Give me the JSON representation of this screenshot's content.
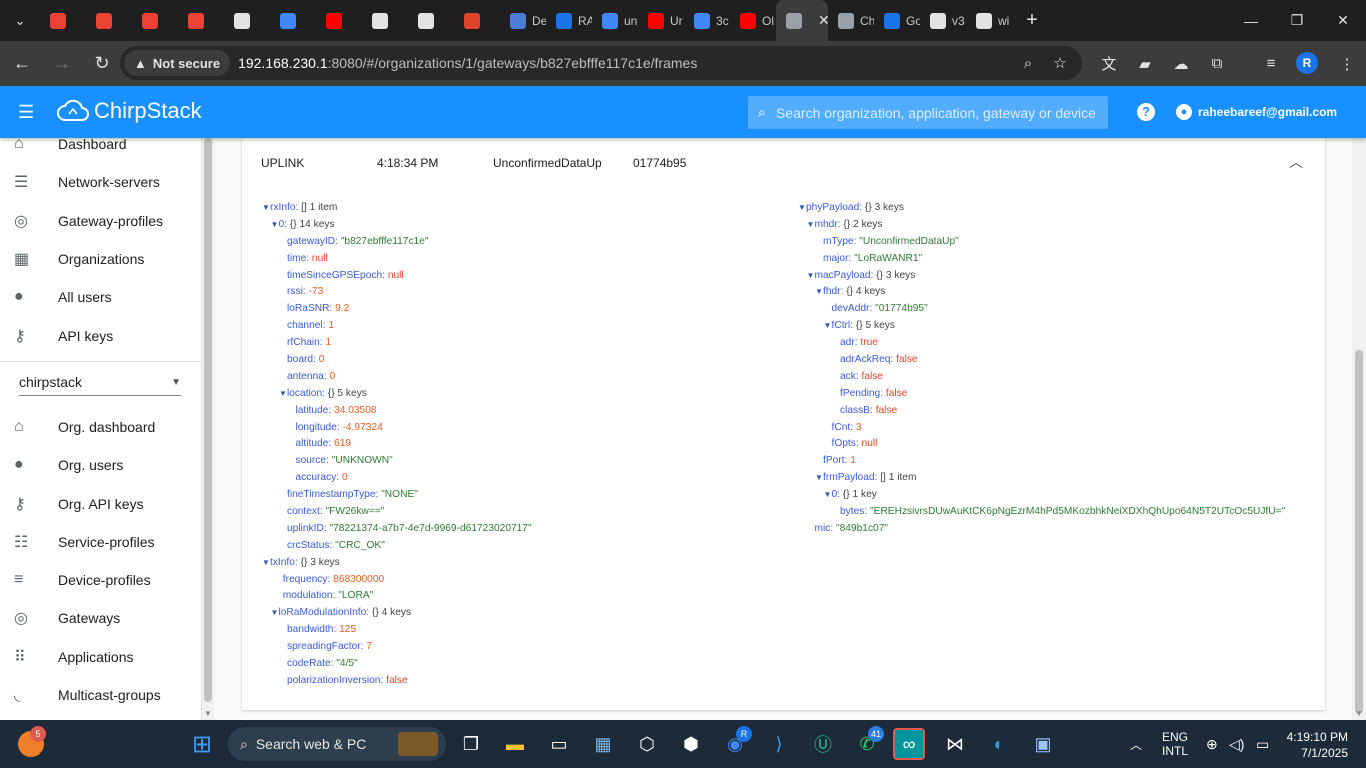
{
  "browser": {
    "tabs": [
      {
        "title": "",
        "color": "#ea4335"
      },
      {
        "title": "",
        "color": "#ea4335"
      },
      {
        "title": "",
        "color": "#ea4335"
      },
      {
        "title": "",
        "color": "#ea4335"
      },
      {
        "title": "",
        "color": "#e3e3e3"
      },
      {
        "title": "",
        "color": "#4285f4"
      },
      {
        "title": "",
        "color": "#ff0000"
      },
      {
        "title": "",
        "color": "#e3e3e3"
      },
      {
        "title": "",
        "color": "#e3e3e3"
      },
      {
        "title": "",
        "color": "#e0442c"
      },
      {
        "title": "De",
        "color": "#4c7bd8"
      },
      {
        "title": "RA",
        "color": "#1a73e8"
      },
      {
        "title": "un",
        "color": "#4285f4"
      },
      {
        "title": "Ur",
        "color": "#ff0000"
      },
      {
        "title": "3c",
        "color": "#4285f4"
      },
      {
        "title": "Ol",
        "color": "#ff0000"
      },
      {
        "title": "",
        "color": "#9aa0a6",
        "active": true
      },
      {
        "title": "Ch",
        "color": "#9aa0a6"
      },
      {
        "title": "Go",
        "color": "#1a73e8"
      },
      {
        "title": "v3",
        "color": "#e3e3e3"
      },
      {
        "title": "wi",
        "color": "#e3e3e3"
      }
    ],
    "not_secure": "Not secure",
    "url_host": "192.168.230.1",
    "url_rest": ":8080/#/organizations/1/gateways/b827ebfffe117c1e/frames",
    "profile_initial": "R"
  },
  "app": {
    "brand": "ChirpStack",
    "search_placeholder": "Search organization, application, gateway or device",
    "user_email": "raheebareef@gmail.com",
    "accent": "#1890ff"
  },
  "sidebar": {
    "top_items": [
      {
        "label": "Dashboard",
        "icon": "home-icon"
      },
      {
        "label": "Network-servers",
        "icon": "servers-icon"
      },
      {
        "label": "Gateway-profiles",
        "icon": "gateway-icon"
      },
      {
        "label": "Organizations",
        "icon": "domain-icon"
      },
      {
        "label": "All users",
        "icon": "user-icon"
      },
      {
        "label": "API keys",
        "icon": "key-icon"
      }
    ],
    "org_selected": "chirpstack",
    "org_items": [
      {
        "label": "Org. dashboard",
        "icon": "home-icon"
      },
      {
        "label": "Org. users",
        "icon": "user-icon"
      },
      {
        "label": "Org. API keys",
        "icon": "key-icon"
      },
      {
        "label": "Service-profiles",
        "icon": "account-details-icon"
      },
      {
        "label": "Device-profiles",
        "icon": "tune-icon"
      },
      {
        "label": "Gateways",
        "icon": "gateway-icon"
      },
      {
        "label": "Applications",
        "icon": "apps-icon"
      },
      {
        "label": "Multicast-groups",
        "icon": "rss-icon"
      }
    ]
  },
  "frame": {
    "direction": "UPLINK",
    "time": "4:18:34 PM",
    "message_type": "UnconfirmedDataUp",
    "dev_addr": "01774b95"
  },
  "left_tree": [
    {
      "indent": 0,
      "arrow": true,
      "key": "rxInfo",
      "meta": "[] 1 item"
    },
    {
      "indent": 1,
      "arrow": true,
      "key": "0",
      "meta": "{} 14 keys"
    },
    {
      "indent": 2,
      "key": "gatewayID",
      "value": "\"b827ebfffe117c1e\"",
      "vtype": "s"
    },
    {
      "indent": 2,
      "key": "time",
      "value": "null",
      "vtype": "b"
    },
    {
      "indent": 2,
      "key": "timeSinceGPSEpoch",
      "value": "null",
      "vtype": "b"
    },
    {
      "indent": 2,
      "key": "rssi",
      "value": "-73",
      "vtype": "n"
    },
    {
      "indent": 2,
      "key": "loRaSNR",
      "value": "9.2",
      "vtype": "n"
    },
    {
      "indent": 2,
      "key": "channel",
      "value": "1",
      "vtype": "n"
    },
    {
      "indent": 2,
      "key": "rfChain",
      "value": "1",
      "vtype": "n"
    },
    {
      "indent": 2,
      "key": "board",
      "value": "0",
      "vtype": "n"
    },
    {
      "indent": 2,
      "key": "antenna",
      "value": "0",
      "vtype": "n"
    },
    {
      "indent": 2,
      "arrow": true,
      "key": "location",
      "meta": "{} 5 keys"
    },
    {
      "indent": 3,
      "key": "latitude",
      "value": "34.03508",
      "vtype": "n"
    },
    {
      "indent": 3,
      "key": "longitude",
      "value": "-4.97324",
      "vtype": "n"
    },
    {
      "indent": 3,
      "key": "altitude",
      "value": "619",
      "vtype": "n"
    },
    {
      "indent": 3,
      "key": "source",
      "value": "\"UNKNOWN\"",
      "vtype": "s"
    },
    {
      "indent": 3,
      "key": "accuracy",
      "value": "0",
      "vtype": "n"
    },
    {
      "indent": 2,
      "key": "fineTimestampType",
      "value": "\"NONE\"",
      "vtype": "s"
    },
    {
      "indent": 2,
      "key": "context",
      "value": "\"FW26kw==\"",
      "vtype": "s"
    },
    {
      "indent": 2,
      "key": "uplinkID",
      "value": "\"78221374-a7b7-4e7d-9969-d61723020717\"",
      "vtype": "s"
    },
    {
      "indent": 2,
      "key": "crcStatus",
      "value": "\"CRC_OK\"",
      "vtype": "s"
    },
    {
      "indent": 0,
      "arrow": true,
      "key": "txInfo",
      "meta": "{} 3 keys"
    },
    {
      "indent": 1.5,
      "key": "frequency",
      "value": "868300000",
      "vtype": "n"
    },
    {
      "indent": 1.5,
      "key": "modulation",
      "value": "\"LORA\"",
      "vtype": "s"
    },
    {
      "indent": 1,
      "arrow": true,
      "key": "loRaModulationInfo",
      "meta": "{} 4 keys"
    },
    {
      "indent": 2,
      "key": "bandwidth",
      "value": "125",
      "vtype": "n"
    },
    {
      "indent": 2,
      "key": "spreadingFactor",
      "value": "7",
      "vtype": "n"
    },
    {
      "indent": 2,
      "key": "codeRate",
      "value": "\"4/5\"",
      "vtype": "s"
    },
    {
      "indent": 2,
      "key": "polarizationInversion",
      "value": "false",
      "vtype": "b"
    }
  ],
  "right_tree": [
    {
      "indent": 0,
      "arrow": true,
      "key": "phyPayload",
      "meta": "{} 3 keys"
    },
    {
      "indent": 1,
      "arrow": true,
      "key": "mhdr",
      "meta": "{} 2 keys"
    },
    {
      "indent": 2,
      "key": "mType",
      "value": "\"UnconfirmedDataUp\"",
      "vtype": "s"
    },
    {
      "indent": 2,
      "key": "major",
      "value": "\"LoRaWANR1\"",
      "vtype": "s"
    },
    {
      "indent": 1,
      "arrow": true,
      "key": "macPayload",
      "meta": "{} 3 keys"
    },
    {
      "indent": 2,
      "arrow": true,
      "key": "fhdr",
      "meta": "{} 4 keys"
    },
    {
      "indent": 3,
      "key": "devAddr",
      "value": "\"01774b95\"",
      "vtype": "s"
    },
    {
      "indent": 3,
      "arrow": true,
      "key": "fCtrl",
      "meta": "{} 5 keys"
    },
    {
      "indent": 4,
      "key": "adr",
      "value": "true",
      "vtype": "b"
    },
    {
      "indent": 4,
      "key": "adrAckReq",
      "value": "false",
      "vtype": "b"
    },
    {
      "indent": 4,
      "key": "ack",
      "value": "false",
      "vtype": "b"
    },
    {
      "indent": 4,
      "key": "fPending",
      "value": "false",
      "vtype": "b"
    },
    {
      "indent": 4,
      "key": "classB",
      "value": "false",
      "vtype": "b"
    },
    {
      "indent": 3,
      "key": "fCnt",
      "value": "3",
      "vtype": "n"
    },
    {
      "indent": 3,
      "key": "fOpts",
      "value": "null",
      "vtype": "b"
    },
    {
      "indent": 2,
      "key": "fPort",
      "value": "1",
      "vtype": "n"
    },
    {
      "indent": 2,
      "arrow": true,
      "key": "frmPayload",
      "meta": "[] 1 item"
    },
    {
      "indent": 3,
      "arrow": true,
      "key": "0",
      "meta": "{} 1 key"
    },
    {
      "indent": 4,
      "key": "bytes",
      "value": "\"EREHzsivrsDUwAuKtCK6pNgEzrM4hPd5MKozbhkNeiXDXhQhUpo64N5T2UTcOc5UJfU=\"",
      "vtype": "s"
    },
    {
      "indent": 1,
      "key": "mic",
      "value": "\"849b1c07\"",
      "vtype": "s"
    }
  ],
  "taskbar": {
    "search_label": "Search web & PC",
    "badge_left": "5",
    "badge_chrome": "R",
    "badge_whatsapp": "41",
    "lang_line1": "ENG",
    "lang_line2": "INTL",
    "time": "4:19:10 PM",
    "date": "7/1/2025"
  }
}
